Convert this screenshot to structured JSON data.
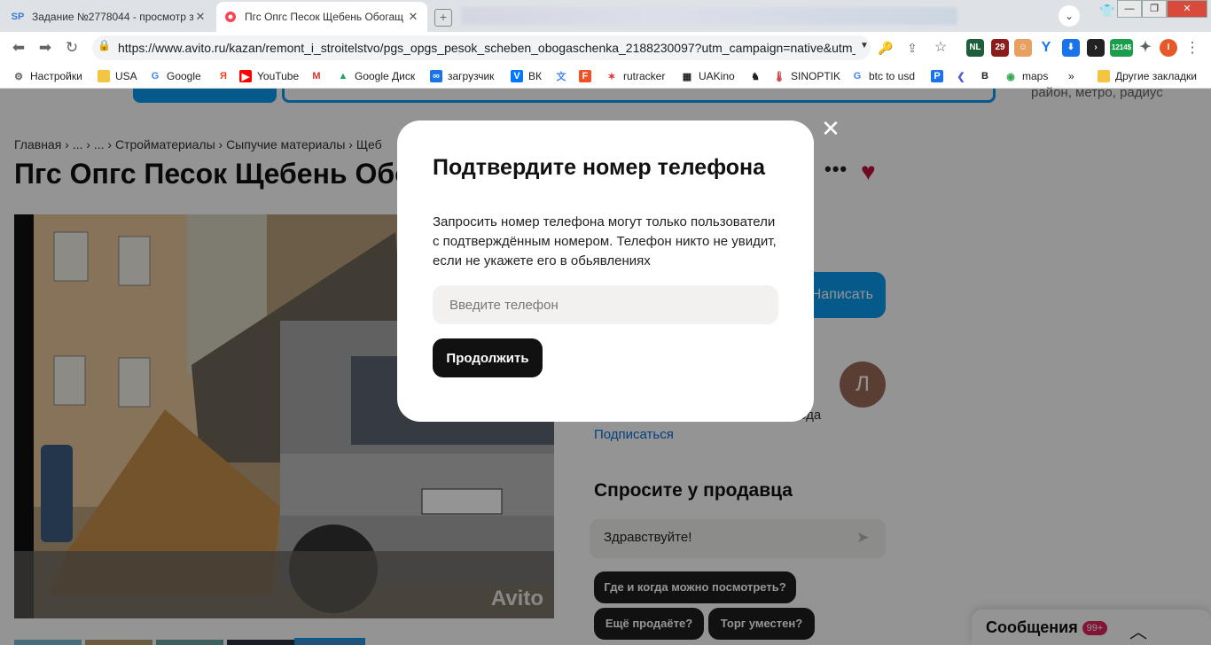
{
  "browser": {
    "tabs": [
      {
        "title": "Задание №2778044 - просмотр з",
        "favicon": "SP"
      },
      {
        "title": "Пгс Опгс Песок Щебень Обогащ",
        "favicon": "avito-icon"
      }
    ],
    "url": "https://www.avito.ru/kazan/remont_i_stroitelstvo/pgs_opgs_pesok_scheben_obogaschenka_2188230097?utm_campaign=native&utm_...",
    "profile_initial": "I",
    "bookmarks": [
      {
        "label": "Настройки",
        "icon": "gear-icon"
      },
      {
        "label": "USA",
        "icon": "folder-icon"
      },
      {
        "label": "Google",
        "icon": "google-icon"
      },
      {
        "label": "",
        "icon": "yandex-icon"
      },
      {
        "label": "YouTube",
        "icon": "youtube-icon"
      },
      {
        "label": "",
        "icon": "gmail-icon"
      },
      {
        "label": "Google Диск",
        "icon": "drive-icon"
      },
      {
        "label": "загрузчик",
        "icon": "loader-icon"
      },
      {
        "label": "ВК",
        "icon": "vk-icon"
      },
      {
        "label": "",
        "icon": "translate-icon"
      },
      {
        "label": "",
        "icon": "f-icon"
      },
      {
        "label": "rutracker",
        "icon": "rutracker-icon"
      },
      {
        "label": "UAKino",
        "icon": "uakino-icon"
      },
      {
        "label": "",
        "icon": "chess-icon"
      },
      {
        "label": "SINOPTIK",
        "icon": "thermometer-icon"
      },
      {
        "label": "btc to usd",
        "icon": "google-icon"
      },
      {
        "label": "",
        "icon": "p-icon"
      },
      {
        "label": "",
        "icon": "arrow-icon"
      },
      {
        "label": "",
        "icon": "bc-icon"
      },
      {
        "label": "maps",
        "icon": "maps-icon"
      },
      {
        "label": "»",
        "icon": ""
      },
      {
        "label": "Другие закладки",
        "icon": "folder-icon"
      }
    ],
    "ext_badges": {
      "nl": "NL",
      "count": "29",
      "counter": "1214$"
    }
  },
  "page": {
    "location_hint": "район, метро, радиус",
    "breadcrumb": "Главная › ... › ... › Стройматериалы › Сыпучие материалы › Щеб",
    "title": "Пгс Опгс Песок Щебень Обогащенка",
    "write_button": "Написать",
    "seller_initial": "Л",
    "seller_since": "года",
    "subscribe": "Подписаться",
    "ask_title": "Спросите у продавца",
    "message_text": "Здравствуйте!",
    "quick_questions": [
      "Где и когда можно посмотреть?",
      "Ещё продаёте?",
      "Торг уместен?"
    ],
    "photo_watermark": "Avito",
    "messages_panel": {
      "label": "Сообщения",
      "badge": "99+"
    }
  },
  "modal": {
    "title": "Подтвердите номер телефона",
    "description": "Запросить номер телефона могут только пользователи с подтверждённым номером. Телефон никто не увидит, если не укажете его в обьявлениях",
    "phone_placeholder": "Введите телефон",
    "continue_label": "Продолжить"
  },
  "colors": {
    "accent": "#0a9bf0",
    "heart": "#c0113a",
    "badge": "#e0245e"
  }
}
